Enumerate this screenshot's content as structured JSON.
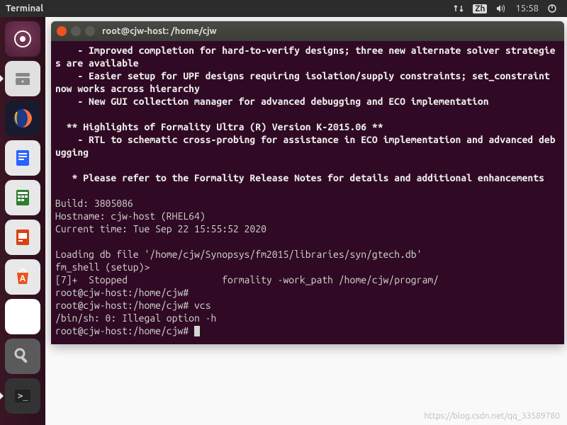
{
  "topbar": {
    "app_title": "Terminal",
    "ime": "Zh",
    "time": "15:58"
  },
  "launcher": {
    "items": [
      {
        "name": "dash",
        "glyph": "◌"
      },
      {
        "name": "files",
        "glyph": "🗄"
      },
      {
        "name": "firefox",
        "glyph": "🦊"
      },
      {
        "name": "writer",
        "glyph": "📄"
      },
      {
        "name": "calc",
        "glyph": "📊"
      },
      {
        "name": "impress",
        "glyph": "📋"
      },
      {
        "name": "software",
        "glyph": "🛍"
      },
      {
        "name": "amazon",
        "glyph": "a"
      },
      {
        "name": "settings",
        "glyph": "⚙"
      },
      {
        "name": "terminal",
        "glyph": ">_"
      }
    ]
  },
  "terminal": {
    "title": "root@cjw-host: /home/cjw",
    "lines": {
      "l01": "    - Improved completion for hard-to-verify designs; three new alternate solver strategies are available",
      "l02": "    - Easier setup for UPF designs requiring isolation/supply constraints; set_constraint now works across hierarchy",
      "l03": "    - New GUI collection manager for advanced debugging and ECO implementation",
      "l04": "",
      "l05": "  ** Highlights of Formality Ultra (R) Version K-2015.06 **",
      "l06": "    - RTL to schematic cross-probing for assistance in ECO implementation and advanced debugging",
      "l07": "",
      "l08": "   * Please refer to the Formality Release Notes for details and additional enhancements",
      "l09": "",
      "l10": "Build: 3805086",
      "l11": "Hostname: cjw-host (RHEL64)",
      "l12": "Current time: Tue Sep 22 15:55:52 2020",
      "l13": "",
      "l14": "Loading db file '/home/cjw/Synopsys/fm2015/libraries/syn/gtech.db'",
      "l15": "fm_shell (setup)>",
      "l16": "[7]+  Stopped                 formality -work_path /home/cjw/program/",
      "p_user": "root@cjw-host",
      "p_sep": ":",
      "p_path": "/home/cjw",
      "p_hash": "#",
      "cmd_vcs": " vcs",
      "l18": "/bin/sh: 0: Illegal option -h"
    }
  },
  "watermark": "https://blog.csdn.net/qq_33589780"
}
